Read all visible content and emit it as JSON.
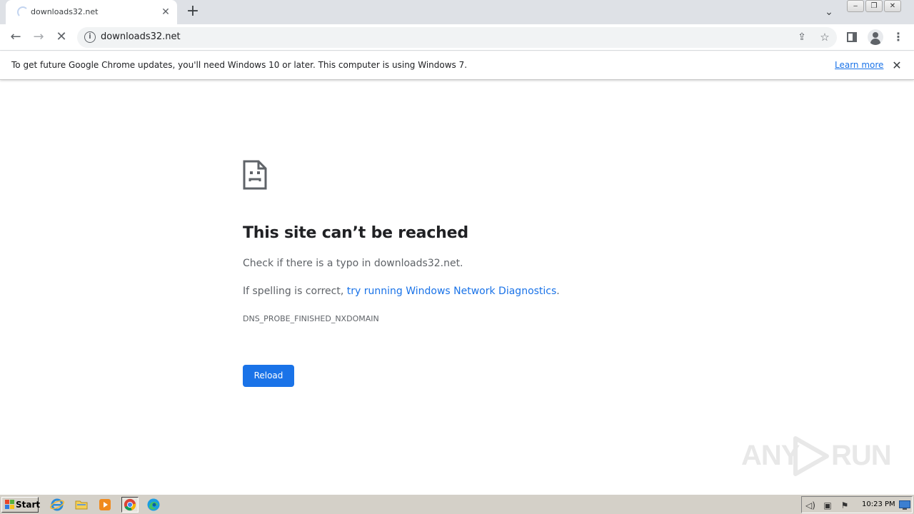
{
  "tab": {
    "title": "downloads32.net",
    "close_glyph": "✕",
    "new_tab_glyph": "+",
    "tab_search_glyph": "⌄"
  },
  "window": {
    "minimize_glyph": "‒",
    "restore_glyph": "❐",
    "close_glyph": "✕"
  },
  "toolbar": {
    "back_glyph": "←",
    "forward_glyph": "→",
    "stop_glyph": "✕",
    "url": "downloads32.net",
    "info_glyph": "i",
    "share_glyph": "⇪",
    "star_glyph": "☆",
    "menu_glyph": "⋮"
  },
  "infobar": {
    "message": "To get future Google Chrome updates, you'll need Windows 10 or later. This computer is using Windows 7.",
    "link": "Learn more",
    "close_glyph": "✕"
  },
  "error": {
    "title": "This site can’t be reached",
    "line1": "Check if there is a typo in downloads32.net.",
    "line2_prefix": "If spelling is correct, ",
    "line2_link": "try running Windows Network Diagnostics",
    "line2_suffix": ".",
    "code": "DNS_PROBE_FINISHED_NXDOMAIN",
    "reload_label": "Reload"
  },
  "watermark": {
    "left": "ANY",
    "right": "RUN"
  },
  "taskbar": {
    "start_label": "Start",
    "clock": "10:23 PM",
    "tray_volume_glyph": "◁)",
    "tray_network_glyph": "▣",
    "tray_flag_glyph": "⚑"
  },
  "colors": {
    "accent": "#1a73e8",
    "text_primary": "#202124",
    "text_secondary": "#5f6368",
    "tab_strip": "#dee1e6",
    "taskbar": "#d4d0c8"
  },
  "icons": [
    "loading-spinner-icon",
    "close-icon",
    "plus-icon",
    "chevron-down-icon",
    "back-arrow-icon",
    "forward-arrow-icon",
    "stop-icon",
    "info-icon",
    "share-icon",
    "star-icon",
    "side-panel-icon",
    "profile-icon",
    "menu-dots-icon",
    "sad-page-icon",
    "windows-flag-icon",
    "ie-icon",
    "folder-icon",
    "media-player-icon",
    "chrome-icon",
    "edge-icon",
    "volume-icon",
    "network-icon",
    "action-center-flag-icon"
  ]
}
